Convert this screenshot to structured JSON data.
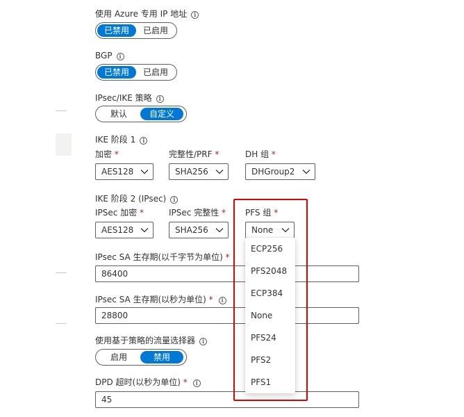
{
  "azure_ip": {
    "label": "使用 Azure 专用 IP 地址",
    "options": [
      "已禁用",
      "已启用"
    ]
  },
  "bgp": {
    "label": "BGP",
    "options": [
      "已禁用",
      "已启用"
    ]
  },
  "ipsec_policy": {
    "label": "IPsec/IKE 策略",
    "options": [
      "默认",
      "自定义"
    ]
  },
  "ike_phase1": {
    "heading": "IKE 阶段 1",
    "encryption": {
      "label": "加密",
      "value": "AES128"
    },
    "integrity": {
      "label": "完整性/PRF",
      "value": "SHA256"
    },
    "dh_group": {
      "label": "DH 组",
      "value": "DHGroup2"
    }
  },
  "ike_phase2": {
    "heading": "IKE 阶段 2 (IPsec)",
    "encryption": {
      "label": "IPSec 加密",
      "value": "AES128"
    },
    "integrity": {
      "label": "IPSec 完整性",
      "value": "SHA256"
    },
    "pfs_group": {
      "label": "PFS 组",
      "value": "None"
    }
  },
  "required_mark": "*",
  "sa_kb": {
    "label": "IPsec SA 生存期(以千字节为单位)",
    "value": "86400"
  },
  "sa_sec": {
    "label": "IPsec SA 生存期(以秒为单位)",
    "value": "28800"
  },
  "policy_selectors": {
    "label": "使用基于策略的流量选择器",
    "options": [
      "启用",
      "禁用"
    ]
  },
  "dpd": {
    "label": "DPD 超时(以秒为单位)",
    "value": "45"
  },
  "pfs_dropdown": {
    "items": [
      "ECP256",
      "PFS2048",
      "ECP384",
      "None",
      "PFS24",
      "PFS2",
      "PFS1"
    ]
  },
  "colors": {
    "accent": "#0078d4",
    "required": "#a4262c",
    "highlight": "#e00000"
  }
}
